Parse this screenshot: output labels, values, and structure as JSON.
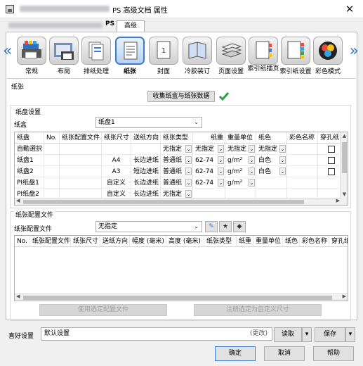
{
  "window": {
    "title": "PS 高级文档 属性",
    "close_glyph": "✕"
  },
  "tabs": [
    {
      "label": "PS"
    },
    {
      "label": "高级"
    }
  ],
  "categories": [
    {
      "label": "常规",
      "icon": "printer-general-icon"
    },
    {
      "label": "布局",
      "icon": "layout-icon"
    },
    {
      "label": "排纸处理",
      "icon": "finishing-icon"
    },
    {
      "label": "纸张",
      "icon": "paper-icon",
      "selected": true
    },
    {
      "label": "封面",
      "icon": "cover-icon"
    },
    {
      "label": "冷胶装订",
      "icon": "perfect-binding-icon"
    },
    {
      "label": "页面设置",
      "icon": "page-setting-icon"
    },
    {
      "label": "索引纸插页",
      "icon": "tab-insert-icon"
    },
    {
      "label": "索引纸设置",
      "icon": "tab-setting-icon"
    },
    {
      "label": "彩色模式",
      "icon": "color-mode-icon"
    }
  ],
  "paper_section": {
    "label": "纸张",
    "collect_button": "收集纸盒与纸张数据",
    "tray_settings_label": "纸盘设置",
    "tray_field_label": "纸盒",
    "tray_value": "纸盘1",
    "columns": [
      "纸盘",
      "No.",
      "纸张配置文件",
      "纸张尺寸",
      "送纸方向",
      "纸张类型",
      "纸重",
      "重量单位",
      "纸色",
      "彩色名称",
      "穿孔纸"
    ],
    "rows": [
      {
        "tray": "自動選択",
        "no": "",
        "profile": "",
        "size": "",
        "dir": "",
        "type": "无指定",
        "weight": "无指定",
        "unit": "无指定",
        "color": "无指定",
        "colorname": "",
        "punch": true
      },
      {
        "tray": "纸盘1",
        "no": "",
        "profile": "",
        "size": "A4",
        "dir": "长边进纸",
        "type": "普通纸",
        "weight": "62-74",
        "unit": "g/m²",
        "color": "白色",
        "colorname": "",
        "punch": true
      },
      {
        "tray": "纸盘2",
        "no": "",
        "profile": "",
        "size": "A3",
        "dir": "短边进纸",
        "type": "普通纸",
        "weight": "62-74",
        "unit": "g/m²",
        "color": "白色",
        "colorname": "",
        "punch": true
      },
      {
        "tray": "PI纸盘1",
        "no": "",
        "profile": "",
        "size": "自定义",
        "dir": "长边进纸",
        "type": "普通纸",
        "weight": "62-74",
        "unit": "g/m²",
        "color": "",
        "colorname": "",
        "punch": false
      },
      {
        "tray": "PI纸盘2",
        "no": "",
        "profile": "",
        "size": "自定义",
        "dir": "长边进纸",
        "type": "无指定",
        "weight": "",
        "unit": "",
        "color": "",
        "colorname": "",
        "punch": false
      }
    ]
  },
  "profile_section": {
    "label": "纸张配置文件",
    "field_label": "纸张配置文件",
    "field_value": "无指定",
    "columns": [
      "No.",
      "纸张配置文件",
      "纸张尺寸",
      "送纸方向",
      "幅度 (毫米)",
      "高度 (毫米)",
      "纸张类型",
      "纸重",
      "重量单位",
      "纸色",
      "彩色名称",
      "穿孔纸"
    ],
    "use_selected_button": "使用选定配置文件",
    "register_custom_button": "注册选定为自定义尺寸"
  },
  "footer": {
    "favorites_label": "喜好设置",
    "favorites_value": "默认设置",
    "changed_label": "(更改)",
    "load_button": "读取",
    "save_button": "保存",
    "ok_button": "确定",
    "cancel_button": "取消",
    "help_button": "帮助"
  },
  "colors": {
    "accent": "#3a7bd5",
    "check": "#2e9e3e"
  }
}
